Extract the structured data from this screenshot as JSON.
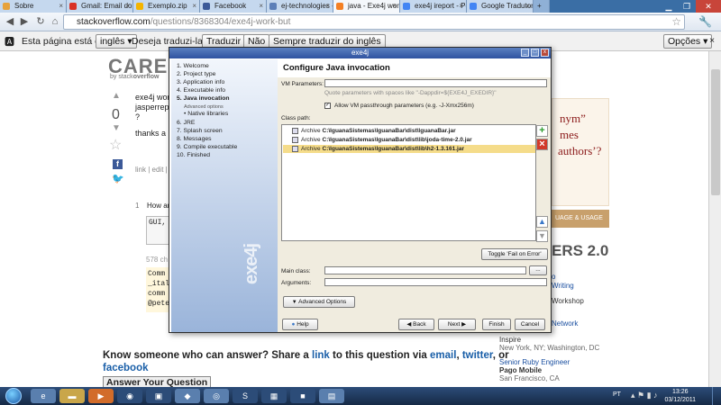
{
  "browser": {
    "tabs": [
      {
        "label": "Sobre",
        "color": "#e6a23c"
      },
      {
        "label": "Gmail: Email do Go",
        "color": "#d93025"
      },
      {
        "label": "Exemplo.zip",
        "color": "#f4b400"
      },
      {
        "label": "Facebook",
        "color": "#3b5998"
      },
      {
        "label": "ej-technologies - Ja",
        "color": "#5c7fb8"
      },
      {
        "label": "java - Exe4j work, b",
        "color": "#f48024"
      },
      {
        "label": "exe4j ireport - Pesq",
        "color": "#4285f4"
      },
      {
        "label": "Google Tradutor",
        "color": "#4285f4"
      }
    ],
    "active_tab_index": 5,
    "url_host": "stackoverflow.com",
    "url_path": "/questions/8368304/exe4j-work-but"
  },
  "translate_bar": {
    "text": "Esta página está em",
    "language": "inglês",
    "question": "Deseja traduzi-la?",
    "translate": "Traduzir",
    "no": "Não",
    "always": "Sempre traduzir do inglês",
    "options": "Opções"
  },
  "so_page": {
    "logo": "CAREE",
    "logo_sub_prefix": "by stack",
    "logo_sub_bold": "overflow",
    "vote_count": "0",
    "post_line1": "exe4j work",
    "post_line2": "jasperrepo",
    "post_line3": "?",
    "thanks": "thanks a lo",
    "links": "link | edit |",
    "comment_num": "1",
    "comment_text": "How an",
    "code_snippet": "GUI,",
    "chars_left": "578 ch",
    "comments": [
      "Comm",
      "_ital",
      "comm",
      "@pete"
    ],
    "ad_quote_line1": "nym”",
    "ad_quote_line2": "mes",
    "ad_quote_line3": "authors’?",
    "ad_footer": "UAGE & USAGE",
    "careers_title": "ERS 2.0",
    "job_lines": [
      "o",
      "Writing",
      "Workshop",
      "",
      "Network"
    ],
    "job1_company": "Inspire",
    "job1_location": "New York, NY; Washington, DC",
    "job2_title": "Senior Ruby Engineer",
    "job2_company": "Pago Mobile",
    "job2_location": "San Francisco, CA",
    "share_text_1": "Know someone who can answer? Share a",
    "share_link": "link",
    "share_text_2": "to this question via",
    "share_email": "email",
    "share_twitter": "twitter",
    "share_or": ", or",
    "share_facebook": "facebook",
    "answer_button": "Answer Your Question"
  },
  "dialog": {
    "title": "exe4j",
    "header": "Configure Java invocation",
    "steps": [
      {
        "label": "1. Welcome",
        "bold": false
      },
      {
        "label": "2. Project type",
        "bold": false
      },
      {
        "label": "3. Application info",
        "bold": false
      },
      {
        "label": "4. Executable info",
        "bold": false
      },
      {
        "label": "5. Java invocation",
        "bold": true
      },
      {
        "label": "Advanced options",
        "sub": true
      },
      {
        "label": "• Native libraries",
        "bold": false,
        "indent": true
      },
      {
        "label": "6. JRE",
        "bold": false
      },
      {
        "label": "7. Splash screen",
        "bold": false
      },
      {
        "label": "8. Messages",
        "bold": false
      },
      {
        "label": "9. Compile executable",
        "bold": false
      },
      {
        "label": "10. Finished",
        "bold": false
      }
    ],
    "vm_params_label": "VM Parameters:",
    "vm_params_value": "",
    "vm_hint": "Quote parameters with spaces like \"-Dappdir=${EXE4J_EXEDIR}\"",
    "allow_passthrough": "Allow VM passthrough parameters (e.g. -J-Xmx256m)",
    "allow_passthrough_checked": true,
    "classpath_label": "Class path:",
    "classpath": [
      {
        "kind": "Archive",
        "path": "C:\\IguanaSistemas\\IguanaBar\\dist\\IguanaBar.jar",
        "selected": false
      },
      {
        "kind": "Archive",
        "path": "C:\\IguanaSistemas\\IguanaBar\\dist\\lib\\joda-time-2.0.jar",
        "selected": false
      },
      {
        "kind": "Archive",
        "path": "C:\\IguanaSistemas\\IguanaBar\\dist\\lib\\h2-1.3.161.jar",
        "selected": true
      }
    ],
    "toggle_fail": "Toggle 'Fail on Error'",
    "main_class_label": "Main class:",
    "main_class_value": "",
    "browse": "...",
    "arguments_label": "Arguments:",
    "arguments_value": "",
    "advanced_options": "Advanced Options",
    "help": "Help",
    "back": "Back",
    "next": "Next",
    "finish": "Finish",
    "cancel": "Cancel",
    "logo": "exe4j"
  },
  "taskbar": {
    "time": "13:26",
    "date": "03/12/2011",
    "language": "PT"
  }
}
